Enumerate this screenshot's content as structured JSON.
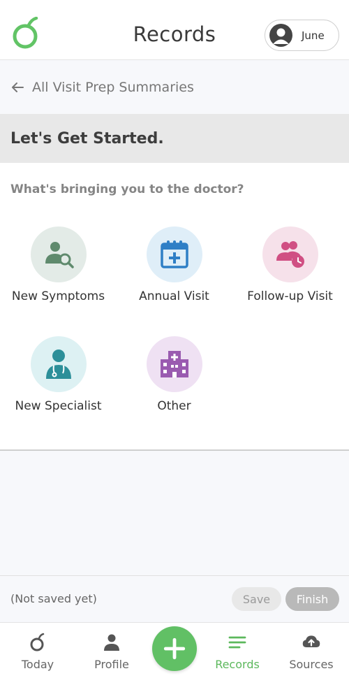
{
  "header": {
    "title": "Records",
    "user_name": "June"
  },
  "back_link": {
    "label": "All Visit Prep Summaries"
  },
  "section": {
    "title": "Let's Get Started."
  },
  "question": "What's bringing you to the doctor?",
  "options": [
    {
      "label": "New Symptoms",
      "icon": "person-search-icon",
      "color": "#5f8a6d",
      "bg": "#e3ebe7"
    },
    {
      "label": "Annual Visit",
      "icon": "calendar-plus-icon",
      "color": "#2f7fc6",
      "bg": "#dfeef8"
    },
    {
      "label": "Follow-up Visit",
      "icon": "people-clock-icon",
      "color": "#d04f83",
      "bg": "#f6e1ea"
    },
    {
      "label": "New Specialist",
      "icon": "doctor-icon",
      "color": "#2c8f99",
      "bg": "#ddf1f3"
    },
    {
      "label": "Other",
      "icon": "hospital-icon",
      "color": "#9a5bb0",
      "bg": "#efe1f3"
    }
  ],
  "save_bar": {
    "status": "(Not saved yet)",
    "save_label": "Save",
    "finish_label": "Finish"
  },
  "nav": {
    "items": [
      {
        "label": "Today",
        "icon": "today-icon"
      },
      {
        "label": "Profile",
        "icon": "person-icon"
      },
      {
        "label": "Records",
        "icon": "records-icon",
        "active": true
      },
      {
        "label": "Sources",
        "icon": "cloud-upload-icon"
      }
    ],
    "fab_icon": "plus-icon"
  },
  "colors": {
    "brand_green": "#5cb85c",
    "fab_green": "#61c065"
  }
}
